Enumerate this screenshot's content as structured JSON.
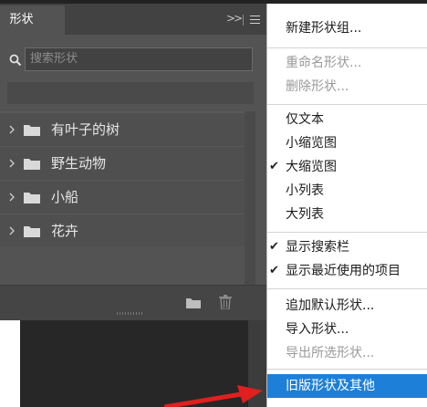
{
  "panel": {
    "tab_title": "形状",
    "search_placeholder": "搜索形状",
    "folders": [
      {
        "label": "有叶子的树"
      },
      {
        "label": "野生动物"
      },
      {
        "label": "小船"
      },
      {
        "label": "花卉"
      }
    ]
  },
  "menu": {
    "items": [
      {
        "label": "新建形状组...",
        "enabled": true
      },
      {
        "label": "重命名形状...",
        "enabled": false
      },
      {
        "label": "删除形状...",
        "enabled": false
      },
      {
        "label": "仅文本",
        "enabled": true
      },
      {
        "label": "小缩览图",
        "enabled": true
      },
      {
        "label": "大缩览图",
        "enabled": true,
        "checked": true
      },
      {
        "label": "小列表",
        "enabled": true
      },
      {
        "label": "大列表",
        "enabled": true
      },
      {
        "label": "显示搜索栏",
        "enabled": true,
        "checked": true
      },
      {
        "label": "显示最近使用的项目",
        "enabled": true,
        "checked": true
      },
      {
        "label": "追加默认形状...",
        "enabled": true
      },
      {
        "label": "导入形状...",
        "enabled": true
      },
      {
        "label": "导出所选形状...",
        "enabled": false
      },
      {
        "label": "旧版形状及其他",
        "enabled": true,
        "highlighted": true
      }
    ]
  },
  "colors": {
    "panel_bg": "#535353",
    "menu_highlight": "#1e7fd8",
    "annotation_arrow": "#e0201e"
  }
}
